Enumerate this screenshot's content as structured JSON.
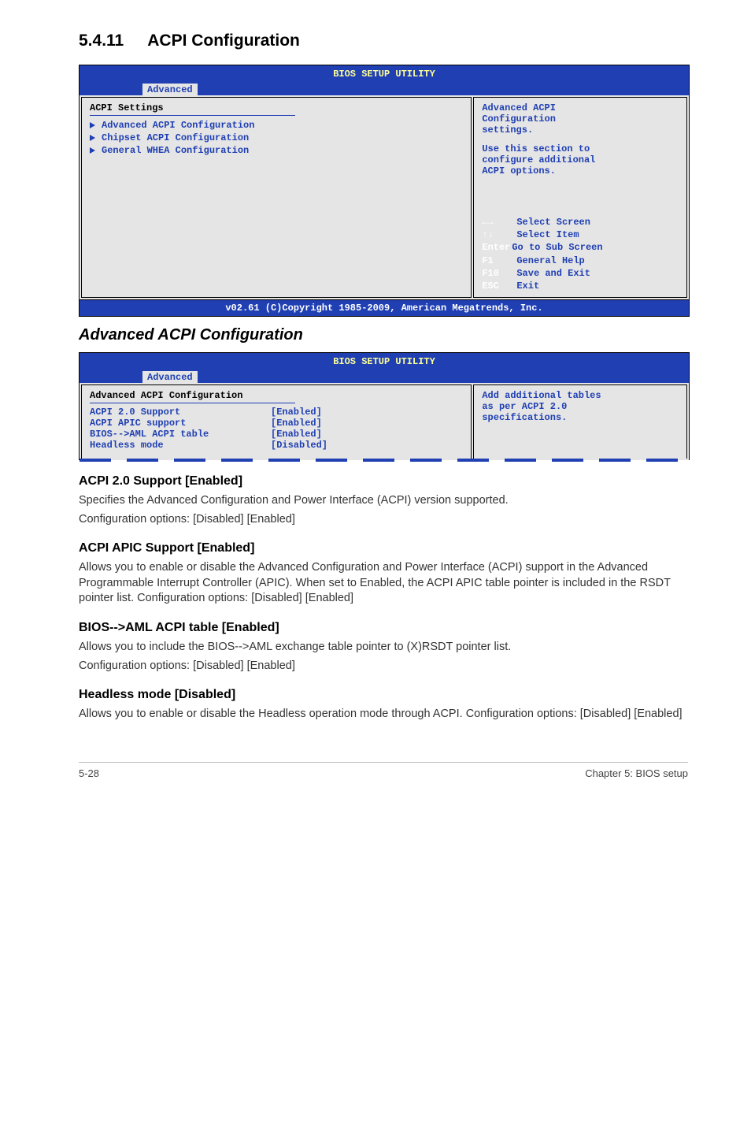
{
  "heading": {
    "number": "5.4.11",
    "title": "ACPI Configuration"
  },
  "bios1": {
    "utility_title": "BIOS SETUP UTILITY",
    "tab": "Advanced",
    "left_title": "ACPI Settings",
    "menu": [
      "Advanced ACPI Configuration",
      "Chipset ACPI Configuration",
      "General WHEA Configuration"
    ],
    "right_help": [
      "Advanced ACPI",
      "Configuration",
      "settings.",
      "",
      "Use this section to",
      "configure additional",
      "ACPI options."
    ],
    "nav": [
      {
        "sym": "←→",
        "label": "Select Screen"
      },
      {
        "sym": "↑↓",
        "label": "Select Item"
      },
      {
        "sym": "Enter",
        "label": "Go to Sub Screen"
      },
      {
        "sym": "F1",
        "label": "General Help"
      },
      {
        "sym": "F10",
        "label": "Save and Exit"
      },
      {
        "sym": "ESC",
        "label": "Exit"
      }
    ],
    "footer": "v02.61 (C)Copyright 1985-2009, American Megatrends, Inc."
  },
  "subhead_advanced": "Advanced ACPI Configuration",
  "bios2": {
    "utility_title": "BIOS SETUP UTILITY",
    "tab": "Advanced",
    "left_title": "Advanced ACPI Configuration",
    "settings": [
      {
        "label": "ACPI 2.0 Support",
        "value": "[Enabled]"
      },
      {
        "label": "ACPI APIC support",
        "value": "[Enabled]"
      },
      {
        "label": "BIOS-->AML ACPI table",
        "value": "[Enabled]"
      },
      {
        "label": "Headless mode",
        "value": "[Disabled]"
      }
    ],
    "right_help": [
      "Add additional tables",
      "as per ACPI 2.0",
      "specifications."
    ]
  },
  "sections": [
    {
      "title": "ACPI 2.0 Support [Enabled]",
      "paras": [
        "Specifies the Advanced Configuration and Power Interface (ACPI) version supported.",
        "Configuration options: [Disabled] [Enabled]"
      ]
    },
    {
      "title": "ACPI APIC Support [Enabled]",
      "paras": [
        "Allows you to enable or disable the Advanced Configuration and Power Interface (ACPI) support in the Advanced Programmable Interrupt Controller (APIC). When set to Enabled, the ACPI APIC table pointer is included in the RSDT pointer list. Configuration options: [Disabled] [Enabled]"
      ]
    },
    {
      "title": "BIOS-->AML ACPI table [Enabled]",
      "paras": [
        "Allows you to include the BIOS-->AML exchange table pointer to (X)RSDT pointer list.",
        "Configuration options: [Disabled] [Enabled]"
      ]
    },
    {
      "title": "Headless mode [Disabled]",
      "paras": [
        "Allows you to enable or disable the Headless operation mode through ACPI. Configuration options: [Disabled] [Enabled]"
      ]
    }
  ],
  "footer": {
    "left": "5-28",
    "right": "Chapter 5: BIOS setup"
  }
}
